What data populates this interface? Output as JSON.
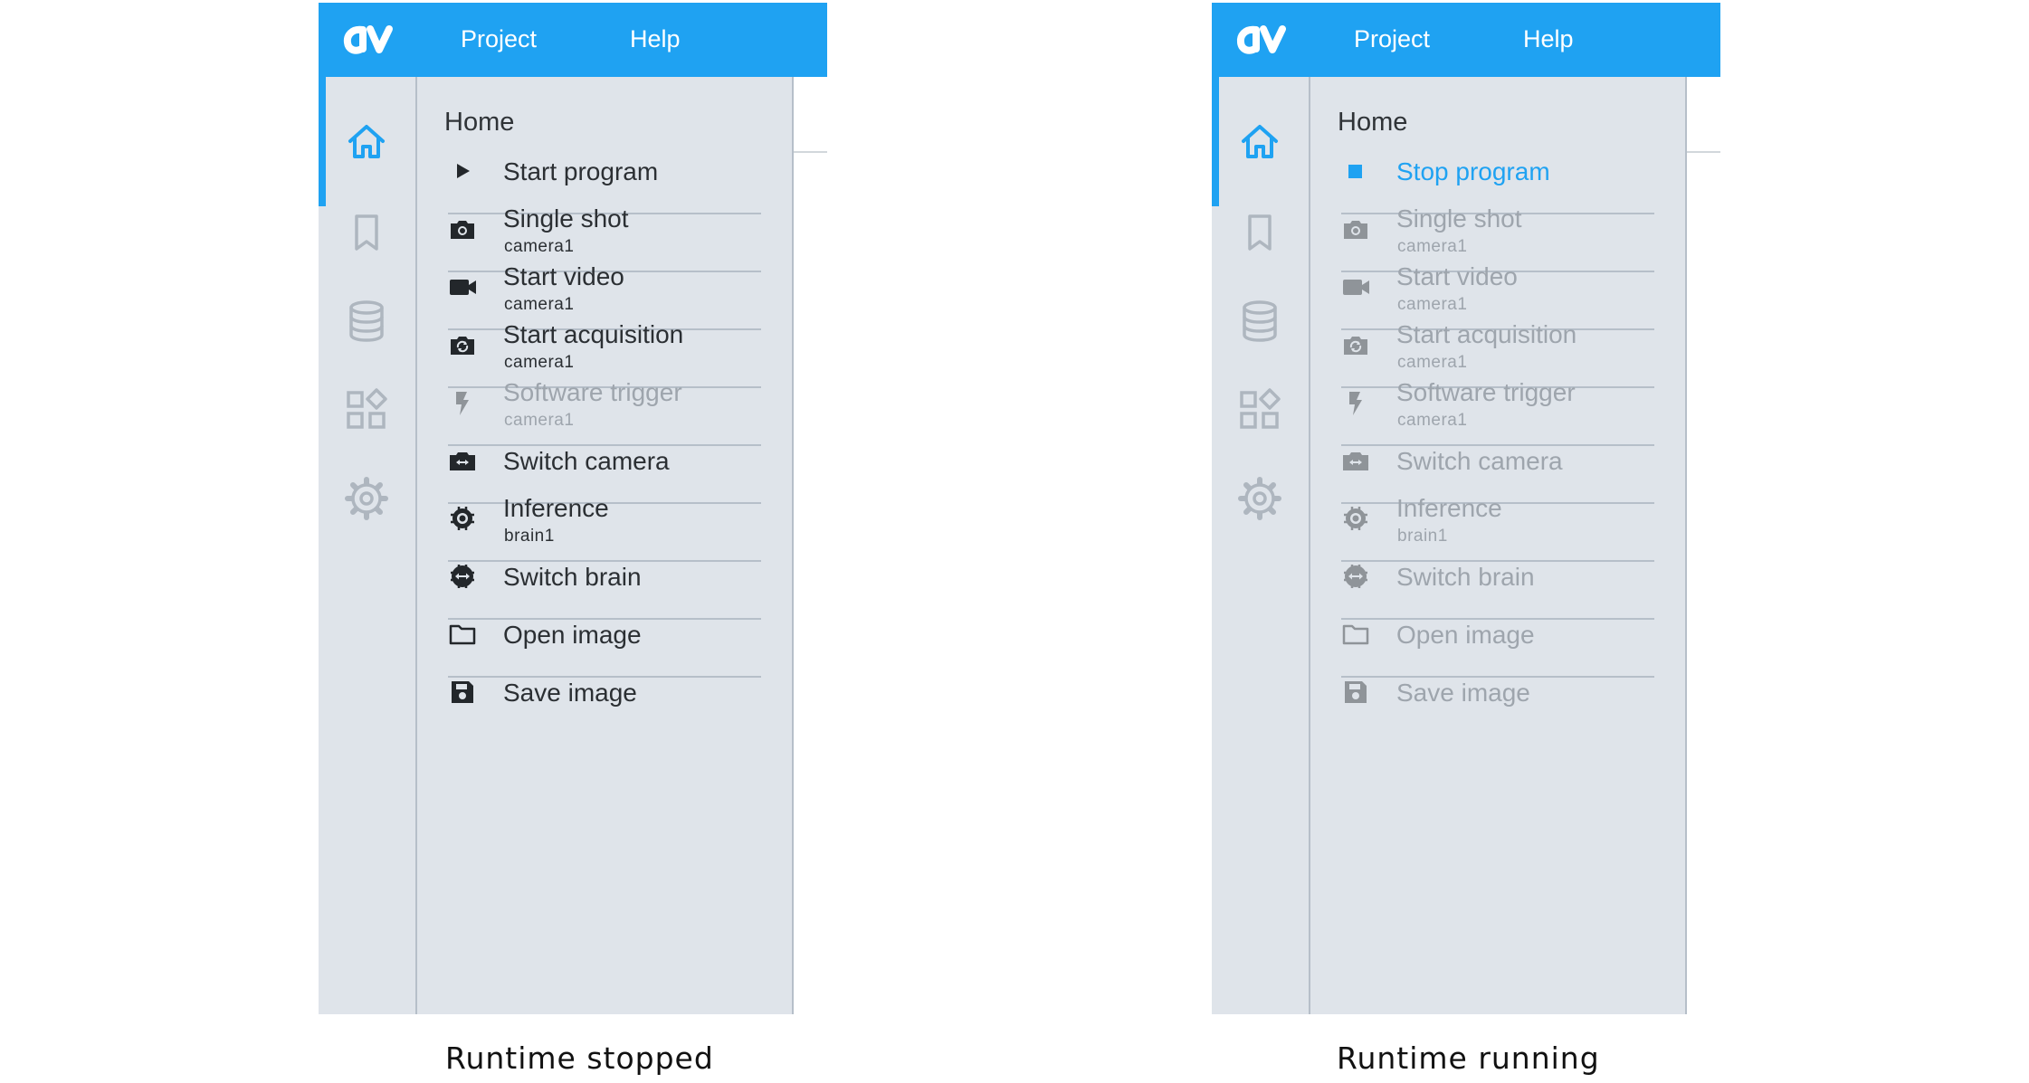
{
  "menubar": {
    "project_label": "Project",
    "help_label": "Help",
    "accent_color": "#1fa2f2"
  },
  "rail": {
    "items": [
      "home-icon",
      "bookmark-icon",
      "database-icon",
      "apps-icon",
      "gear-icon"
    ],
    "active": "home-icon"
  },
  "panels": [
    {
      "caption": "Runtime stopped",
      "title": "Home",
      "items": [
        {
          "label": "Start program",
          "icon": "play-icon",
          "enabled": true
        },
        {
          "label": "Single shot",
          "sub": "camera1",
          "icon": "camera-icon",
          "enabled": true
        },
        {
          "label": "Start video",
          "sub": "camera1",
          "icon": "video-camera-icon",
          "enabled": true
        },
        {
          "label": "Start acquisition",
          "sub": "camera1",
          "icon": "camera-sync-icon",
          "enabled": true
        },
        {
          "label": "Software trigger",
          "sub": "camera1",
          "icon": "lightning-icon",
          "enabled": false
        },
        {
          "label": "Switch camera",
          "icon": "switch-camera-icon",
          "enabled": true
        },
        {
          "label": "Inference",
          "sub": "brain1",
          "icon": "chip-icon",
          "enabled": true
        },
        {
          "label": "Switch brain",
          "icon": "switch-brain-icon",
          "enabled": true
        },
        {
          "label": "Open image",
          "icon": "folder-icon",
          "enabled": true
        },
        {
          "label": "Save image",
          "icon": "floppy-disk-icon",
          "enabled": true
        }
      ]
    },
    {
      "caption": "Runtime running",
      "title": "Home",
      "items": [
        {
          "label": "Stop program",
          "icon": "stop-icon",
          "enabled": true,
          "accent": true
        },
        {
          "label": "Single shot",
          "sub": "camera1",
          "icon": "camera-icon",
          "enabled": false
        },
        {
          "label": "Start video",
          "sub": "camera1",
          "icon": "video-camera-icon",
          "enabled": false
        },
        {
          "label": "Start acquisition",
          "sub": "camera1",
          "icon": "camera-sync-icon",
          "enabled": false
        },
        {
          "label": "Software trigger",
          "sub": "camera1",
          "icon": "lightning-icon",
          "enabled": false
        },
        {
          "label": "Switch camera",
          "icon": "switch-camera-icon",
          "enabled": false
        },
        {
          "label": "Inference",
          "sub": "brain1",
          "icon": "chip-icon",
          "enabled": false
        },
        {
          "label": "Switch brain",
          "icon": "switch-brain-icon",
          "enabled": false
        },
        {
          "label": "Open image",
          "icon": "folder-icon",
          "enabled": false
        },
        {
          "label": "Save image",
          "icon": "floppy-disk-icon",
          "enabled": false
        }
      ]
    }
  ]
}
